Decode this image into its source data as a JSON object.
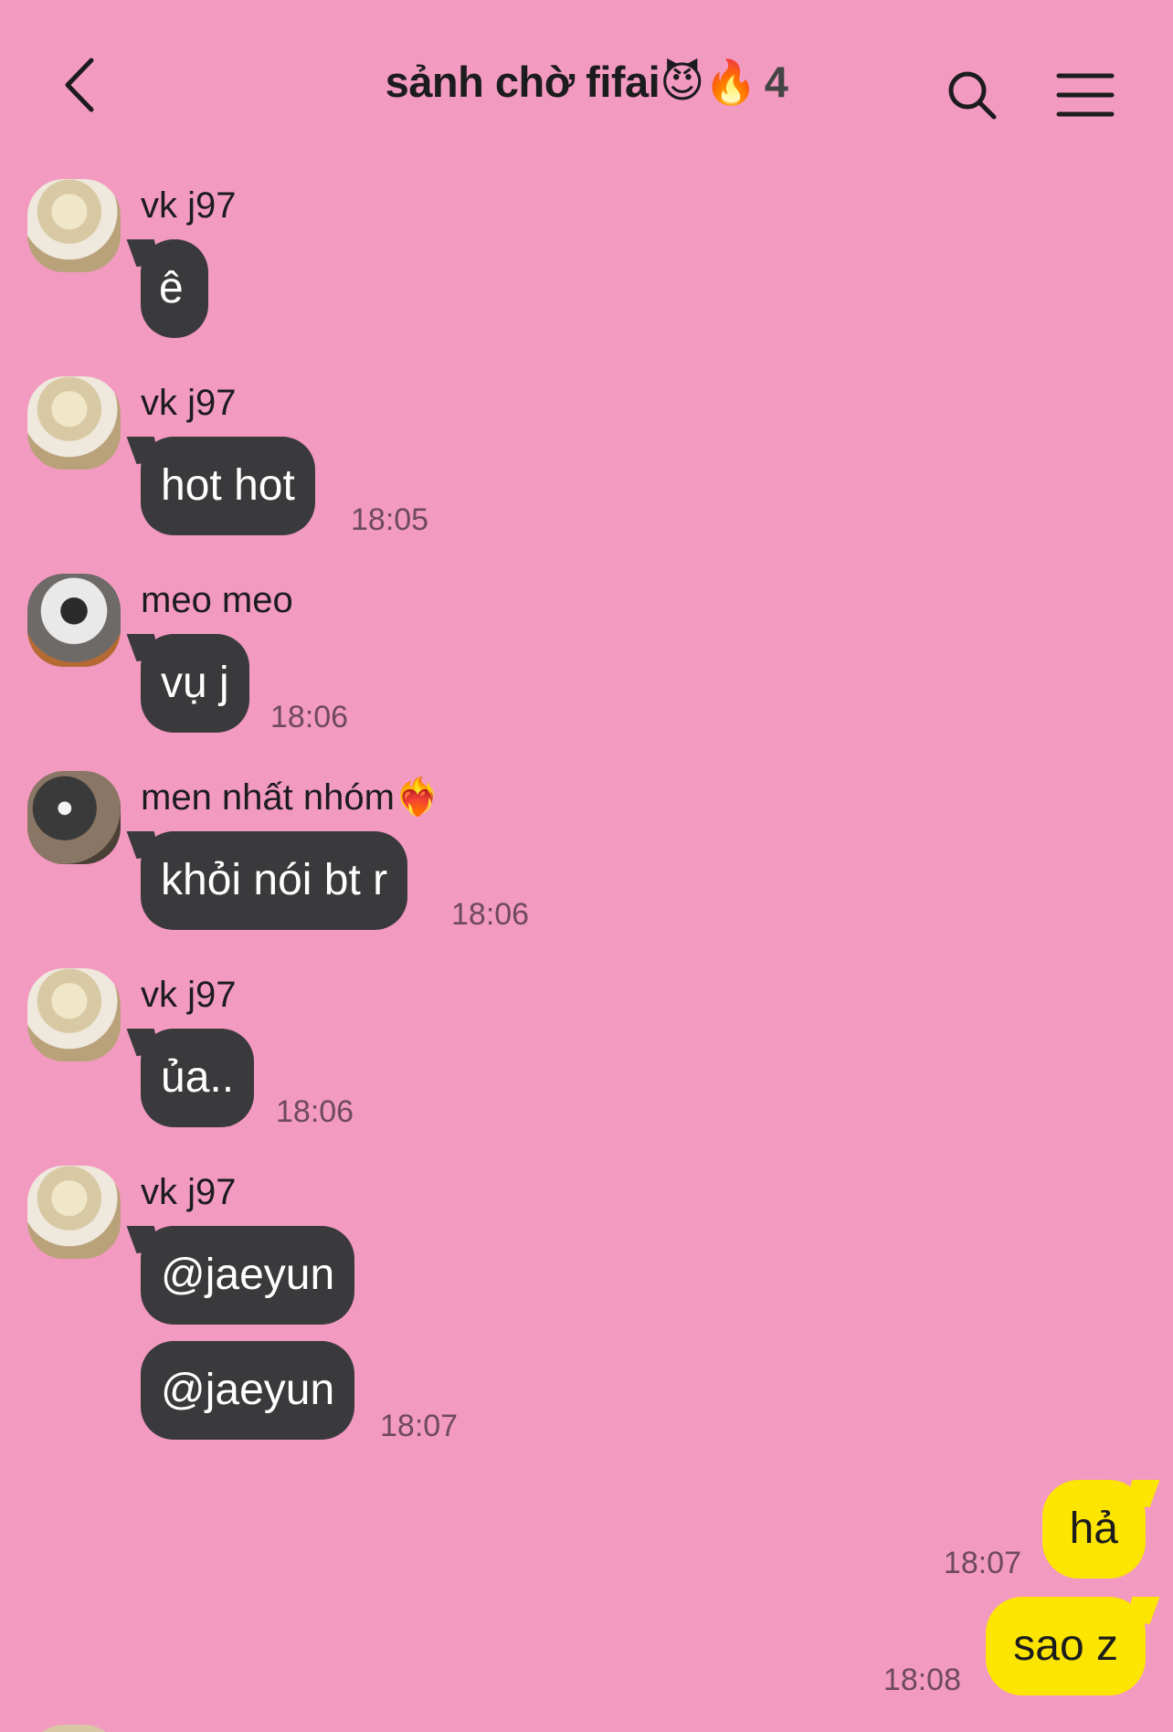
{
  "header": {
    "title": "sảnh chờ fifai😈🔥",
    "member_count": "4",
    "back_icon": "chevron-left-icon",
    "search_icon": "search-icon",
    "menu_icon": "hamburger-menu-icon"
  },
  "messages": [
    {
      "sender": "vk j97",
      "bubbles": [
        "ê"
      ],
      "time": ""
    },
    {
      "sender": "vk j97",
      "bubbles": [
        "hot hot"
      ],
      "time": "18:05"
    },
    {
      "sender": "meo meo",
      "bubbles": [
        "vụ j"
      ],
      "time": "18:06"
    },
    {
      "sender": "men nhất nhóm❤️‍🔥",
      "bubbles": [
        "khỏi nói bt r"
      ],
      "time": "18:06"
    },
    {
      "sender": "vk j97",
      "bubbles": [
        "ủa.."
      ],
      "time": "18:06"
    },
    {
      "sender": "vk j97",
      "bubbles": [
        "@jaeyun",
        "@jaeyun"
      ],
      "time": "18:07"
    }
  ],
  "my_messages": [
    {
      "text": "hả",
      "time": "18:07"
    },
    {
      "text": "sao z",
      "time": "18:08"
    }
  ],
  "colors": {
    "background": "#f39ac1",
    "incoming_bubble": "#3a3a3c",
    "outgoing_bubble": "#fce500"
  }
}
